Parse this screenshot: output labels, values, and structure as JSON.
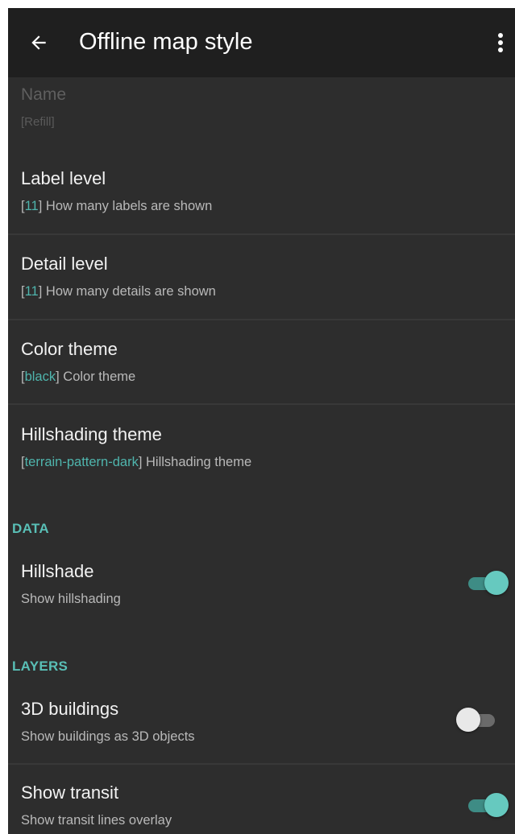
{
  "appbar": {
    "title": "Offline map style"
  },
  "prefs": {
    "name": {
      "title": "Name",
      "summary": "[Refill]"
    },
    "label_level": {
      "title": "Label level",
      "value": "11",
      "summary": "How many labels are shown"
    },
    "detail_level": {
      "title": "Detail level",
      "value": "11",
      "summary": "How many details are shown"
    },
    "color_theme": {
      "title": "Color theme",
      "value": "black",
      "summary": "Color theme"
    },
    "hillshading_theme": {
      "title": "Hillshading theme",
      "value": "terrain-pattern-dark",
      "summary": "Hillshading theme"
    }
  },
  "sections": {
    "data": {
      "header": "DATA",
      "hillshade": {
        "title": "Hillshade",
        "summary": "Show hillshading",
        "enabled": true
      }
    },
    "layers": {
      "header": "LAYERS",
      "buildings_3d": {
        "title": "3D buildings",
        "summary": "Show buildings as 3D objects",
        "enabled": false
      },
      "show_transit": {
        "title": "Show transit",
        "summary": "Show transit lines overlay",
        "enabled": true
      }
    }
  },
  "colors": {
    "background": "#2d2d2d",
    "appbar": "#1f1f1f",
    "accent": "#59bfb6"
  },
  "icons": {
    "back": "arrow-back-icon",
    "more": "more-vert-icon"
  }
}
